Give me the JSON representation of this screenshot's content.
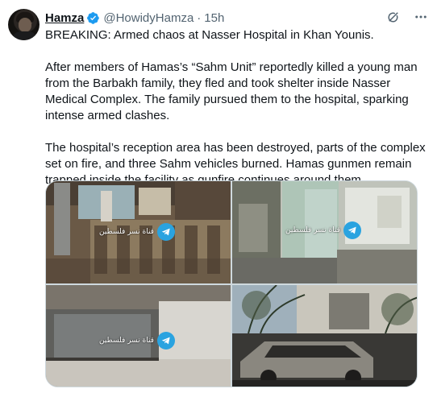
{
  "author": {
    "name": "Hamza",
    "handle": "@HowidyHamza",
    "separator": "·",
    "time": "15h",
    "verified_icon": "verified-badge-icon"
  },
  "header_actions": [
    "grok-icon",
    "more-icon"
  ],
  "tweet_paragraphs": [
    "BREAKING: Armed chaos at Nasser Hospital in Khan Younis.",
    "After members of Hamas’s “Sahm Unit” reportedly killed a young man from the Barbakh family, they fled and took shelter inside Nasser Medical Complex. The family pursued them to the hospital, sparking intense armed clashes.",
    "The hospital’s reception area has been destroyed, parts of the complex set on fire, and three Sahm vehicles burned. Hamas gunmen remain trapped inside the facility as gunfire continues around them."
  ],
  "media": {
    "watermark_text": "قناة نسر فلسطين",
    "watermark_icon": "telegram-icon",
    "images": [
      {
        "name": "hospital-reception-window"
      },
      {
        "name": "hospital-hallway-interior"
      },
      {
        "name": "reception-counter-glass"
      },
      {
        "name": "burned-vehicles"
      }
    ]
  },
  "colors": {
    "text": "#0f1419",
    "muted": "#536471",
    "verified": "#1d9bf0",
    "telegram": "#2aa3e0",
    "border": "#cfd9de"
  }
}
